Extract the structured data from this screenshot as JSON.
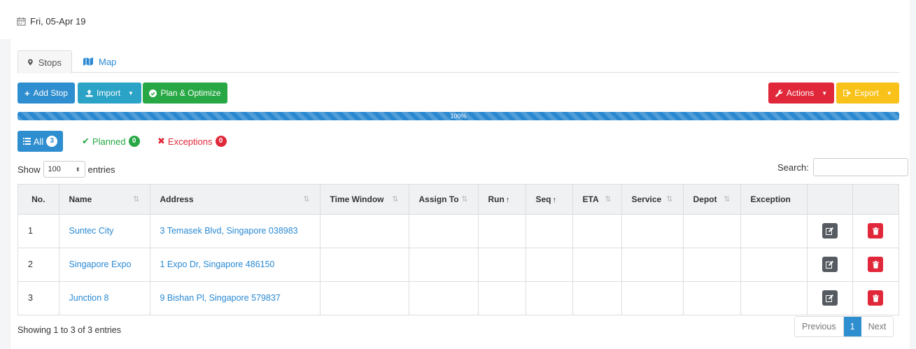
{
  "header": {
    "date": "Fri, 05-Apr 19",
    "calendar_icon": "calendar-icon"
  },
  "tabs": [
    {
      "label": "Stops",
      "icon": "map-marker-icon",
      "active": true
    },
    {
      "label": "Map",
      "icon": "map-icon",
      "active": false
    }
  ],
  "toolbar": {
    "add_stop": "Add Stop",
    "import": "Import",
    "plan_optimize": "Plan & Optimize",
    "actions": "Actions",
    "export": "Export"
  },
  "progress": {
    "label": "100%",
    "value": 1.0
  },
  "filters": {
    "all_label": "All",
    "all_count": "3",
    "planned_label": "Planned",
    "planned_count": "0",
    "exceptions_label": "Exceptions",
    "exceptions_count": "0"
  },
  "length": {
    "show_label": "Show",
    "value": "100",
    "entries_label": "entries"
  },
  "search": {
    "label": "Search:",
    "value": ""
  },
  "table": {
    "columns": [
      "No.",
      "Name",
      "Address",
      "Time Window",
      "Assign To",
      "Run",
      "Seq",
      "ETA",
      "Service",
      "Depot",
      "Exception",
      "",
      ""
    ],
    "rows": [
      {
        "no": "1",
        "name": "Suntec City",
        "address": "3 Temasek Blvd, Singapore 038983"
      },
      {
        "no": "2",
        "name": "Singapore Expo",
        "address": "1 Expo Dr, Singapore 486150"
      },
      {
        "no": "3",
        "name": "Junction 8",
        "address": "9 Bishan Pl, Singapore 579837"
      }
    ]
  },
  "footer": {
    "info": "Showing 1 to 3 of 3 entries",
    "prev": "Previous",
    "page": "1",
    "next": "Next"
  },
  "colors": {
    "primary": "#2f8ecf",
    "info": "#2ba3c6",
    "success": "#27a844",
    "danger": "#e0283a",
    "warning": "#f9c21a",
    "dark": "#555b61"
  }
}
